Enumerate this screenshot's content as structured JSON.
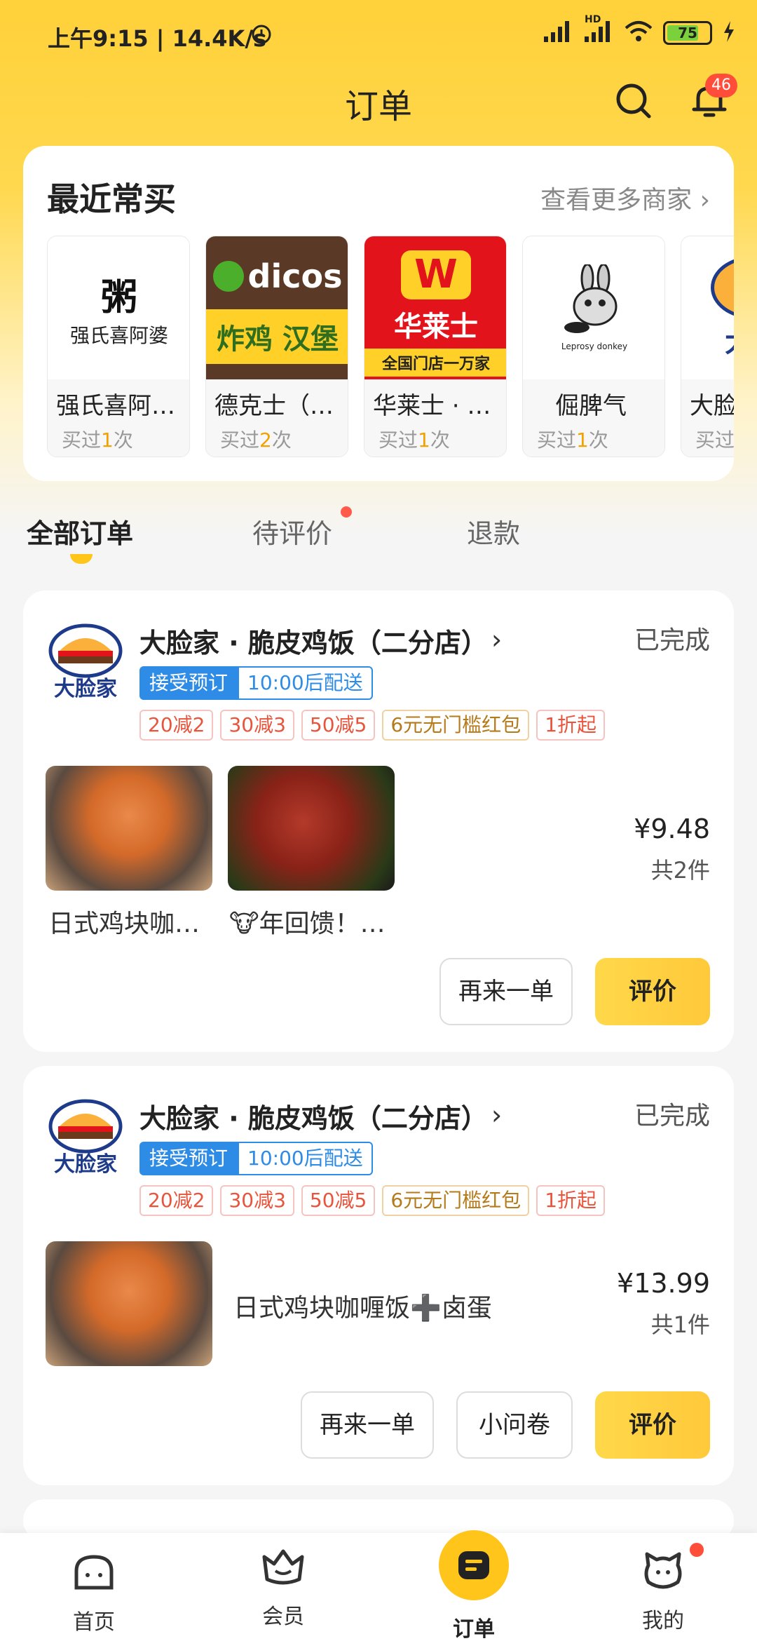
{
  "status_bar": {
    "time": "上午9:15 | 14.4K/s",
    "battery": "75",
    "network": "HD"
  },
  "header": {
    "title": "订单",
    "notification_count": "46"
  },
  "recent": {
    "title": "最近常买",
    "more_label": "查看更多商家 ›",
    "shops": [
      {
        "name": "强氏喜阿…",
        "times_prefix": "买过",
        "times_count": "1",
        "times_suffix": "次",
        "logo_text": "强氏喜阿婆"
      },
      {
        "name": "德克士（…",
        "times_prefix": "买过",
        "times_count": "2",
        "times_suffix": "次",
        "logo_text": "dicos",
        "logo_sub": "炸鸡 汉堡"
      },
      {
        "name": "华莱士 · …",
        "times_prefix": "买过",
        "times_count": "1",
        "times_suffix": "次",
        "logo_text": "华莱士",
        "logo_sub": "全国门店一万家"
      },
      {
        "name": "倔脾气",
        "times_prefix": "买过",
        "times_count": "1",
        "times_suffix": "次",
        "logo_text": "Leprosy donkey"
      },
      {
        "name": "大脸",
        "times_prefix": "买过",
        "times_count": "",
        "times_suffix": "",
        "logo_text": "大脸"
      }
    ]
  },
  "tabs": [
    {
      "label": "全部订单"
    },
    {
      "label": "待评价"
    },
    {
      "label": "退款"
    }
  ],
  "orders": [
    {
      "shop_name": "大脸家 · 脆皮鸡饭（二分店）",
      "status": "已完成",
      "pill_a": "接受预订",
      "pill_b": "10:00后配送",
      "tags": [
        "20减2",
        "30减3",
        "50减5",
        "6元无门槛红包",
        "1折起"
      ],
      "items": [
        "日式鸡块咖…",
        "🐮年回馈！…"
      ],
      "price": "¥9.48",
      "count": "共2件",
      "buttons": [
        "再来一单",
        "评价"
      ],
      "logo_text": "大脸家"
    },
    {
      "shop_name": "大脸家 · 脆皮鸡饭（二分店）",
      "status": "已完成",
      "pill_a": "接受预订",
      "pill_b": "10:00后配送",
      "tags": [
        "20减2",
        "30减3",
        "50减5",
        "6元无门槛红包",
        "1折起"
      ],
      "items": [
        "日式鸡块咖喱饭➕卤蛋"
      ],
      "price": "¥13.99",
      "count": "共1件",
      "buttons": [
        "再来一单",
        "小问卷",
        "评价"
      ],
      "logo_text": "大脸家"
    }
  ],
  "nav": [
    {
      "label": "首页"
    },
    {
      "label": "会员"
    },
    {
      "label": "订单"
    },
    {
      "label": "我的"
    }
  ],
  "colors": {
    "brand_yellow": "#ffc51a",
    "accent_blue": "#2f8ce6",
    "tag_red": "#e8553c",
    "badge_red": "#ff4d3a"
  }
}
